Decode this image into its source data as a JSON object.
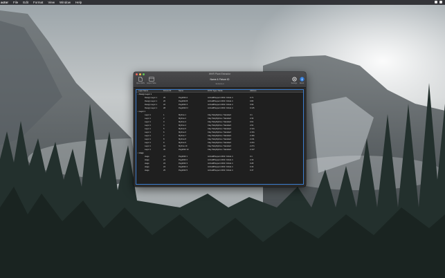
{
  "menubar": {
    "app_name": "actor",
    "items": [
      "File",
      "Edit",
      "Format",
      "View",
      "Window",
      "Help"
    ]
  },
  "window": {
    "title": "WHR Plant Extractor",
    "toolbar": {
      "open_label": "Open DWG",
      "export_label": "Export Table",
      "settings_label": "Settings",
      "about_label": "About"
    },
    "header_main": "Name & Fixture ID",
    "header_sub": "Extracted"
  },
  "table": {
    "columns": [
      "Layer Name",
      "Fixture ID",
      "Name",
      "DXTF Type / Mode",
      "Address"
    ],
    "groups": [
      {
        "label": "Design Layer 1",
        "rows": [
          [
            "Design Layer 1",
            "25",
            "Peg2002 A",
            "ActiveBPeppert 2002 / Mode 4",
            "0.71"
          ],
          [
            "Design Layer 1",
            "26",
            "Peg2002 B",
            "ActiveBPeppert 2002 / Mode 4",
            "0.80"
          ],
          [
            "Design Layer 1",
            "22",
            "Peg2002 X",
            "ActiveBPeppert 2002 / Mode 4",
            "0.99"
          ],
          [
            "Design Layer 1",
            "28",
            "Peg2002 N",
            "ActiveBPeppert 2002 / Mode 4",
            "0.115"
          ]
        ]
      },
      {
        "label": "Layer 1",
        "rows": [
          [
            "Layer 1",
            "1",
            "Mythos 1",
            "Clay PakyMythos / Standard",
            "0.1"
          ],
          [
            "Layer 1",
            "2",
            "Mythos 2",
            "Clay PakyMythos / Standard",
            "2.33"
          ],
          [
            "Layer 1",
            "3",
            "Mythos 3",
            "Clay PakyMythos / Standard",
            "0.61"
          ],
          [
            "Layer 1",
            "4",
            "Mythos 4",
            "Clay PakyMythos / Standard",
            "2.91"
          ],
          [
            "Layer 1",
            "5",
            "Mythos 5",
            "Clay PakyMythos / Standard",
            "2.121"
          ],
          [
            "Layer 1",
            "6",
            "Mythos 6",
            "Clay PakyMythos / Standard",
            "2.151"
          ],
          [
            "Layer 1",
            "7",
            "Mythos 7",
            "Clay PakyMythos / Standard",
            "2.181"
          ],
          [
            "Layer 1",
            "8",
            "Mythos 8",
            "Clay PakyMythos / Standard",
            "2.211"
          ],
          [
            "Layer 1",
            "9",
            "Mythos 9",
            "Clay PakyMythos / Standard",
            "2.241"
          ],
          [
            "Layer 1",
            "10",
            "Mythos 10",
            "Clay PakyMythos / Standard",
            "2.271"
          ],
          [
            "Layer 1",
            "30",
            "Peg2002 10",
            "Clay PakyMythos / Standard",
            "2.127"
          ]
        ]
      },
      {
        "label": "stage",
        "rows": [
          [
            "stage",
            "21",
            "Peg2002 1",
            "ActiveBPeppert 2002 / Mode 4",
            "0.1"
          ],
          [
            "stage",
            "22",
            "Peg2002 2",
            "ActiveBPeppert 2002 / Mode 4",
            "2.16"
          ],
          [
            "stage",
            "23",
            "Peg2002 3",
            "ActiveBPeppert 2002 / Mode 4",
            "0.28"
          ],
          [
            "stage",
            "24",
            "Peg2002 4",
            "ActiveBPeppert 2002 / Mode 4",
            "0.43"
          ],
          [
            "stage",
            "25",
            "Peg2002 5",
            "ActiveBPeppert 2002 / Mode 4",
            "0.47"
          ]
        ]
      }
    ]
  },
  "colors": {
    "selection": "#3c7fd1",
    "window_bg": "#2a2a2a"
  }
}
